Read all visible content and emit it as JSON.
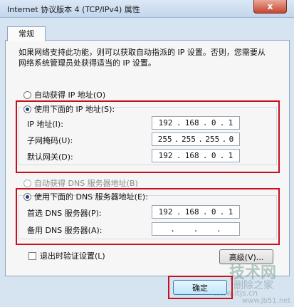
{
  "window": {
    "title": "Internet 协议版本 4 (TCP/IPv4) 属性",
    "close_label": "x"
  },
  "tab": {
    "label": "常规"
  },
  "description": "如果网络支持此功能，则可以获取自动指派的 IP 设置。否则，您需要从网络系统管理员处获得适当的 IP 设置。",
  "ip_section": {
    "auto_label": "自动获得 IP 地址(O)",
    "manual_label": "使用下面的 IP 地址(S):",
    "fields": [
      {
        "label": "IP 地址(I):",
        "octets": [
          "192",
          "168",
          "0",
          "1"
        ]
      },
      {
        "label": "子网掩码(U):",
        "octets": [
          "255",
          "255",
          "255",
          "0"
        ]
      },
      {
        "label": "默认网关(D):",
        "octets": [
          "192",
          "168",
          "0",
          "1"
        ]
      }
    ]
  },
  "dns_section": {
    "auto_label": "自动获得 DNS 服务器地址(B)",
    "manual_label": "使用下面的 DNS 服务器地址(E):",
    "fields": [
      {
        "label": "首选 DNS 服务器(P):",
        "octets": [
          "192",
          "168",
          "0",
          "1"
        ]
      },
      {
        "label": "备用 DNS 服务器(A):",
        "octets": [
          "",
          "",
          "",
          ""
        ]
      }
    ]
  },
  "validate_label": "退出时验证设置(L)",
  "advanced_label": "高级(V)...",
  "ok_label": "确定",
  "watermark": {
    "line1": "技术网",
    "line2": "删除之家",
    "line3": "www.itjs.cn",
    "line4": "www.jb51.net"
  },
  "colors": {
    "highlight_border": "#c8101d",
    "titlebar": "#c3d6ec",
    "close_button": "#c8452f"
  }
}
